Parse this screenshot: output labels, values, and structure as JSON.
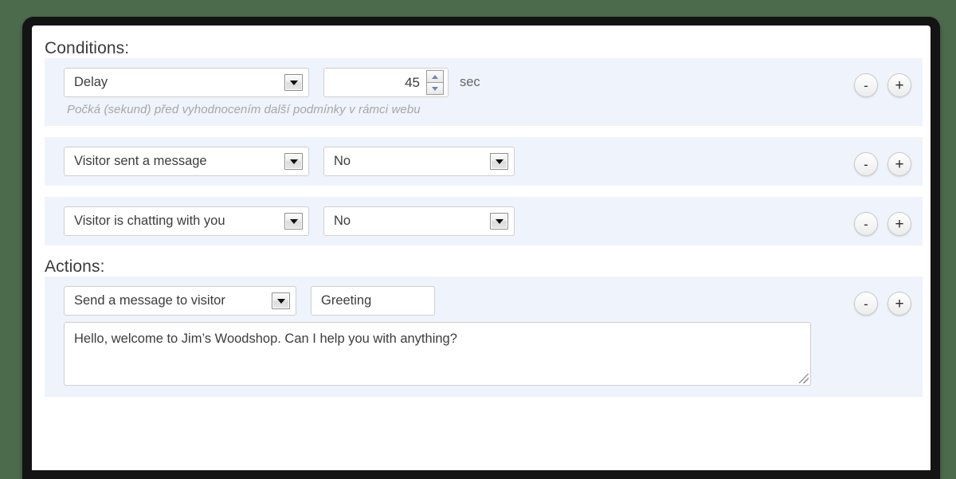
{
  "panel": {
    "conditions_title": "Conditions:",
    "actions_title": "Actions:"
  },
  "conditions": [
    {
      "type_label": "Delay",
      "value_number": "45",
      "unit_label": "sec",
      "helper_text": "Počká (sekund) před vyhodnocením další podmínky v rámci webu",
      "minus_label": "-",
      "plus_label": "+"
    },
    {
      "type_label": "Visitor sent a message",
      "value_label": "No",
      "minus_label": "-",
      "plus_label": "+"
    },
    {
      "type_label": "Visitor is chatting with you",
      "value_label": "No",
      "minus_label": "-",
      "plus_label": "+"
    }
  ],
  "actions": [
    {
      "type_label": "Send a message to visitor",
      "name_value": "Greeting",
      "message_value": "Hello, welcome to Jim’s Woodshop. Can I help you with anything?",
      "minus_label": "-",
      "plus_label": "+"
    }
  ],
  "colors": {
    "page_background": "#4c6b4c",
    "frame_border": "#141414",
    "panel_background": "#ffffff",
    "row_background": "#eff3fb",
    "text": "#3c3c3c",
    "helper_text": "#a6a6a6"
  }
}
